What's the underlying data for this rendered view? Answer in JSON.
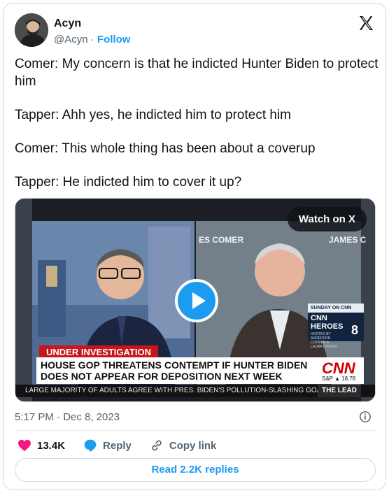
{
  "author": {
    "name": "Acyn",
    "handle": "@Acyn",
    "separator": "·",
    "follow_label": "Follow"
  },
  "tweet": {
    "lines": [
      "Comer: My concern is that he indicted Hunter Biden to protect him",
      "Tapper: Ahh yes, he indicted him to protect him",
      "Comer: This whole thing has been about a coverup",
      "Tapper: He indicted him to cover it up?"
    ]
  },
  "media": {
    "watch_label": "Watch on X",
    "lower_third_label": "UNDER INVESTIGATION",
    "headline_line1": "HOUSE GOP THREATENS CONTEMPT IF HUNTER BIDEN",
    "headline_line2": "DOES NOT APPEAR FOR DEPOSITION NEXT WEEK",
    "network_logo": "CNN",
    "market_ticker": "S&P ▲ 18.78",
    "ticker_text": "LARGE MAJORITY OF ADULTS AGREE WITH PRES. BIDEN'S POLLUTION-SLASHING GOAL",
    "show_name": "THE LEAD",
    "backdrop_nameplate_1": "ES COMER",
    "backdrop_nameplate_2": "JAMES C",
    "promo_top": "SUNDAY ON CNN",
    "promo_title": "CNN HEROES",
    "promo_hosts": "HOSTED BY ANDERSON COOPER & LAURA COATES",
    "promo_time": "8"
  },
  "meta": {
    "timestamp": "5:17 PM · Dec 8, 2023"
  },
  "actions": {
    "likes": "13.4K",
    "reply_label": "Reply",
    "copy_label": "Copy link"
  },
  "replies_label": "Read 2.2K replies",
  "colors": {
    "accent": "#1d9bf0",
    "like": "#f91880",
    "cnn_red": "#cc0000"
  }
}
